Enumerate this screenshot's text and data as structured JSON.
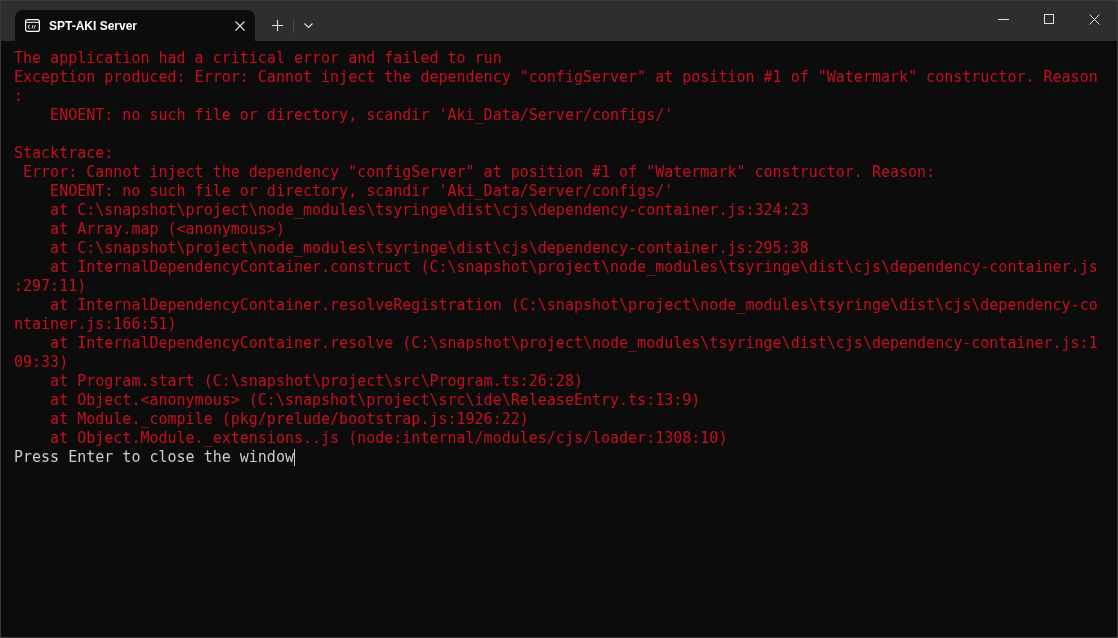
{
  "window": {
    "tab": {
      "title": "SPT-AKI Server",
      "selected": true
    }
  },
  "terminal": {
    "blocks": [
      {
        "lines": [
          {
            "kind": "error",
            "text": "The application had a critical error and failed to run"
          },
          {
            "kind": "error",
            "text": "Exception produced: Error: Cannot inject the dependency \"configServer\" at position #1 of \"Watermark\" constructor. Reason"
          },
          {
            "kind": "error",
            "text": ":"
          },
          {
            "kind": "error",
            "text": "    ENOENT: no such file or directory, scandir 'Aki_Data/Server/configs/'"
          }
        ]
      },
      {
        "lines": [
          {
            "kind": "error",
            "text": "Stacktrace:"
          },
          {
            "kind": "error",
            "text": " Error: Cannot inject the dependency \"configServer\" at position #1 of \"Watermark\" constructor. Reason:"
          },
          {
            "kind": "error",
            "text": "    ENOENT: no such file or directory, scandir 'Aki_Data/Server/configs/'"
          },
          {
            "kind": "error",
            "text": "    at C:\\snapshot\\project\\node_modules\\tsyringe\\dist\\cjs\\dependency-container.js:324:23"
          },
          {
            "kind": "error",
            "text": "    at Array.map (<anonymous>)"
          },
          {
            "kind": "error",
            "text": "    at C:\\snapshot\\project\\node_modules\\tsyringe\\dist\\cjs\\dependency-container.js:295:38"
          },
          {
            "kind": "error",
            "text": "    at InternalDependencyContainer.construct (C:\\snapshot\\project\\node_modules\\tsyringe\\dist\\cjs\\dependency-container.js"
          },
          {
            "kind": "error",
            "text": ":297:11)"
          },
          {
            "kind": "error",
            "text": "    at InternalDependencyContainer.resolveRegistration (C:\\snapshot\\project\\node_modules\\tsyringe\\dist\\cjs\\dependency-co"
          },
          {
            "kind": "error",
            "text": "ntainer.js:166:51)"
          },
          {
            "kind": "error",
            "text": "    at InternalDependencyContainer.resolve (C:\\snapshot\\project\\node_modules\\tsyringe\\dist\\cjs\\dependency-container.js:1"
          },
          {
            "kind": "error",
            "text": "09:33)"
          },
          {
            "kind": "error",
            "text": "    at Program.start (C:\\snapshot\\project\\src\\Program.ts:26:28)"
          },
          {
            "kind": "error",
            "text": "    at Object.<anonymous> (C:\\snapshot\\project\\src\\ide\\ReleaseEntry.ts:13:9)"
          },
          {
            "kind": "error",
            "text": "    at Module._compile (pkg/prelude/bootstrap.js:1926:22)"
          },
          {
            "kind": "error",
            "text": "    at Object.Module._extensions..js (node:internal/modules/cjs/loader:1308:10)"
          },
          {
            "kind": "prompt",
            "text": "Press Enter to close the window"
          }
        ]
      }
    ]
  }
}
